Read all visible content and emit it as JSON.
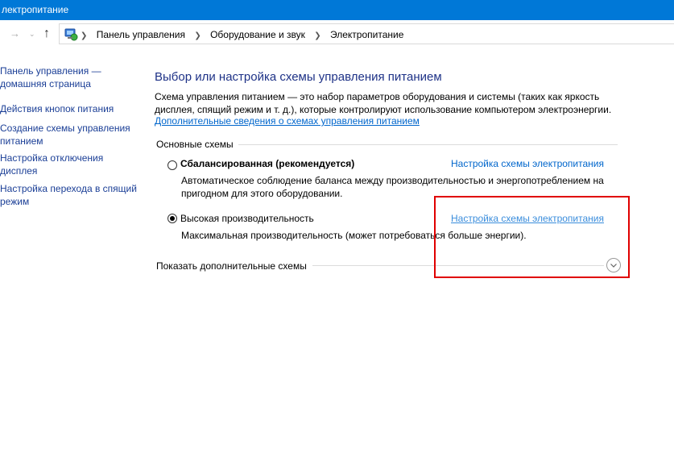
{
  "window": {
    "title": "лектропитание"
  },
  "breadcrumb": [
    "Панель управления",
    "Оборудование и звук",
    "Электропитание"
  ],
  "icons": {
    "back": "arrow-right-icon",
    "dropdown": "chevron-down-icon",
    "up": "arrow-up-icon",
    "control_panel": "control-panel-icon"
  },
  "sidebar": {
    "items": [
      {
        "label": "Панель управления — домашняя страница"
      },
      {
        "label": "Действия кнопок питания"
      },
      {
        "label": "Создание схемы управления питанием"
      },
      {
        "label": "Настройка отключения дисплея"
      },
      {
        "label": "Настройка перехода в спящий режим"
      }
    ]
  },
  "main": {
    "title": "Выбор или настройка схемы управления питанием",
    "description": "Схема управления питанием — это набор параметров оборудования и системы (таких как яркость дисплея, спящий режим и т. д.), которые контролируют использование компьютером электроэнергии.",
    "more_info_link": "Дополнительные сведения о схемах управления питанием",
    "group_label": "Основные схемы",
    "plans": [
      {
        "name": "Сбалансированная (рекомендуется)",
        "selected": false,
        "description": "Автоматическое соблюдение баланса между производительностью и энергопотреблением на пригодном для этого оборудовании.",
        "settings_link": "Настройка схемы электропитания"
      },
      {
        "name": "Высокая производительность",
        "selected": true,
        "description": "Максимальная производительность (может потребоваться больше энергии).",
        "settings_link": "Настройка схемы электропитания"
      }
    ],
    "show_more": "Показать дополнительные схемы"
  },
  "colors": {
    "titlebar": "#0078d7",
    "link": "#0066cc",
    "heading": "#1e3287",
    "highlight": "#e00000"
  }
}
